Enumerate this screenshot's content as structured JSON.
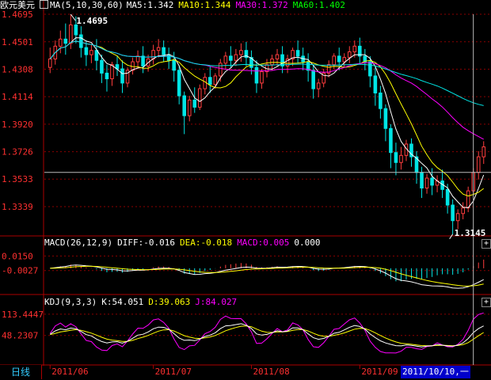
{
  "header": {
    "symbol": "欧元美元",
    "ma_label": "MA(5,10,30,60)",
    "ma5": "MA5:1.342",
    "ma10": "MA10:1.344",
    "ma30": "MA30:1.372",
    "ma60": "MA60:1.402"
  },
  "macd_header": {
    "params": "MACD(26,12,9)",
    "diff": "DIFF:-0.016",
    "dea": "DEA:-0.018",
    "macd": "MACD:0.005",
    "extra": "0.000"
  },
  "kdj_header": {
    "params": "KDJ(9,3,3)",
    "k": "K:54.051",
    "d": "D:39.063",
    "j": "J:84.027"
  },
  "bottom": {
    "tab_label": "日线",
    "cursor_date": "2011/10/10,一"
  },
  "colors": {
    "up": "#ff3d3d",
    "down": "#00e5e5",
    "ma5": "#ffffff",
    "ma10": "#ffff00",
    "ma30": "#ff00ff",
    "ma60": "#00ff00",
    "grid": "#8b0000",
    "axis_text": "#ff3030",
    "diff": "#ffffff",
    "dea": "#ffff00",
    "macd_bar_pos": "#ff3d3d",
    "macd_bar_neg": "#00e5e5",
    "k": "#ffffff",
    "d": "#ffff00",
    "j": "#ff00ff"
  },
  "chart_data": [
    {
      "type": "line",
      "name_hint": "candlestick",
      "y_ticks": [
        "1.4695",
        "1.4501",
        "1.4308",
        "1.4114",
        "1.3920",
        "1.3726",
        "1.3533",
        "1.3339"
      ],
      "ylim": [
        1.315,
        1.4695
      ],
      "annotations": [
        {
          "label": "1.4695",
          "value": 1.4695
        },
        {
          "label": "1.3145",
          "value": 1.3145
        }
      ],
      "x_ticks": [
        "2011/06",
        "2011/07",
        "2011/08",
        "2011/09"
      ],
      "candles": [
        [
          1.432,
          1.446,
          1.438,
          1.428
        ],
        [
          1.438,
          1.451,
          1.447,
          1.434
        ],
        [
          1.447,
          1.458,
          1.452,
          1.442
        ],
        [
          1.452,
          1.463,
          1.449,
          1.441
        ],
        [
          1.449,
          1.4695,
          1.462,
          1.445
        ],
        [
          1.462,
          1.468,
          1.455,
          1.449
        ],
        [
          1.455,
          1.461,
          1.446,
          1.439
        ],
        [
          1.446,
          1.451,
          1.441,
          1.433
        ],
        [
          1.441,
          1.448,
          1.444,
          1.435
        ],
        [
          1.444,
          1.452,
          1.437,
          1.43
        ],
        [
          1.437,
          1.441,
          1.428,
          1.421
        ],
        [
          1.428,
          1.434,
          1.424,
          1.415
        ],
        [
          1.424,
          1.436,
          1.434,
          1.419
        ],
        [
          1.434,
          1.44,
          1.431,
          1.426
        ],
        [
          1.431,
          1.437,
          1.421,
          1.414
        ],
        [
          1.421,
          1.432,
          1.43,
          1.418
        ],
        [
          1.43,
          1.439,
          1.436,
          1.427
        ],
        [
          1.436,
          1.444,
          1.44,
          1.431
        ],
        [
          1.44,
          1.447,
          1.433,
          1.428
        ],
        [
          1.433,
          1.441,
          1.438,
          1.429
        ],
        [
          1.438,
          1.448,
          1.444,
          1.434
        ],
        [
          1.444,
          1.452,
          1.446,
          1.439
        ],
        [
          1.446,
          1.451,
          1.441,
          1.436
        ],
        [
          1.441,
          1.446,
          1.437,
          1.431
        ],
        [
          1.437,
          1.443,
          1.43,
          1.422
        ],
        [
          1.43,
          1.433,
          1.412,
          1.406
        ],
        [
          1.412,
          1.415,
          1.398,
          1.385
        ],
        [
          1.398,
          1.412,
          1.409,
          1.394
        ],
        [
          1.409,
          1.418,
          1.404,
          1.4
        ],
        [
          1.404,
          1.42,
          1.417,
          1.402
        ],
        [
          1.417,
          1.428,
          1.425,
          1.413
        ],
        [
          1.425,
          1.433,
          1.42,
          1.414
        ],
        [
          1.42,
          1.428,
          1.426,
          1.417
        ],
        [
          1.426,
          1.438,
          1.435,
          1.422
        ],
        [
          1.435,
          1.443,
          1.44,
          1.431
        ],
        [
          1.44,
          1.447,
          1.437,
          1.432
        ],
        [
          1.437,
          1.445,
          1.441,
          1.433
        ],
        [
          1.441,
          1.449,
          1.444,
          1.436
        ],
        [
          1.444,
          1.45,
          1.439,
          1.433
        ],
        [
          1.439,
          1.444,
          1.432,
          1.427
        ],
        [
          1.432,
          1.437,
          1.421,
          1.414
        ],
        [
          1.421,
          1.431,
          1.429,
          1.417
        ],
        [
          1.429,
          1.438,
          1.434,
          1.425
        ],
        [
          1.434,
          1.441,
          1.438,
          1.43
        ],
        [
          1.438,
          1.445,
          1.441,
          1.433
        ],
        [
          1.441,
          1.447,
          1.433,
          1.428
        ],
        [
          1.433,
          1.441,
          1.438,
          1.428
        ],
        [
          1.438,
          1.446,
          1.444,
          1.433
        ],
        [
          1.444,
          1.451,
          1.44,
          1.435
        ],
        [
          1.44,
          1.446,
          1.436,
          1.43
        ],
        [
          1.436,
          1.442,
          1.43,
          1.422
        ],
        [
          1.43,
          1.434,
          1.417,
          1.41
        ],
        [
          1.417,
          1.424,
          1.421,
          1.411
        ],
        [
          1.421,
          1.431,
          1.428,
          1.418
        ],
        [
          1.428,
          1.437,
          1.434,
          1.425
        ],
        [
          1.434,
          1.442,
          1.44,
          1.431
        ],
        [
          1.44,
          1.446,
          1.436,
          1.43
        ],
        [
          1.436,
          1.442,
          1.439,
          1.432
        ],
        [
          1.439,
          1.447,
          1.443,
          1.435
        ],
        [
          1.443,
          1.451,
          1.447,
          1.439
        ],
        [
          1.447,
          1.453,
          1.44,
          1.434
        ],
        [
          1.44,
          1.445,
          1.436,
          1.43
        ],
        [
          1.436,
          1.44,
          1.426,
          1.418
        ],
        [
          1.426,
          1.432,
          1.414,
          1.405
        ],
        [
          1.414,
          1.419,
          1.403,
          1.396
        ],
        [
          1.403,
          1.406,
          1.389,
          1.38
        ],
        [
          1.389,
          1.392,
          1.372,
          1.361
        ],
        [
          1.372,
          1.379,
          1.365,
          1.356
        ],
        [
          1.365,
          1.376,
          1.37,
          1.36
        ],
        [
          1.37,
          1.381,
          1.378,
          1.366
        ],
        [
          1.378,
          1.382,
          1.369,
          1.362
        ],
        [
          1.369,
          1.373,
          1.358,
          1.35
        ],
        [
          1.358,
          1.362,
          1.347,
          1.34
        ],
        [
          1.347,
          1.357,
          1.354,
          1.343
        ],
        [
          1.354,
          1.361,
          1.349,
          1.342
        ],
        [
          1.349,
          1.356,
          1.352,
          1.344
        ],
        [
          1.352,
          1.36,
          1.346,
          1.34
        ],
        [
          1.346,
          1.35,
          1.335,
          1.329
        ],
        [
          1.335,
          1.339,
          1.324,
          1.3145
        ],
        [
          1.324,
          1.332,
          1.329,
          1.318
        ],
        [
          1.329,
          1.337,
          1.333,
          1.325
        ],
        [
          1.333,
          1.348,
          1.345,
          1.33
        ],
        [
          1.345,
          1.361,
          1.358,
          1.342
        ],
        [
          1.358,
          1.373,
          1.369,
          1.353
        ],
        [
          1.369,
          1.38,
          1.376,
          1.364
        ]
      ]
    },
    {
      "type": "bar",
      "name_hint": "macd",
      "y_ticks": [
        "0.0150",
        "-0.0027"
      ],
      "ylim": [
        -0.03,
        0.024
      ]
    },
    {
      "type": "line",
      "name_hint": "kdj",
      "y_ticks": [
        "113.4447",
        "48.2307"
      ],
      "ylim": [
        -40,
        135
      ]
    }
  ]
}
